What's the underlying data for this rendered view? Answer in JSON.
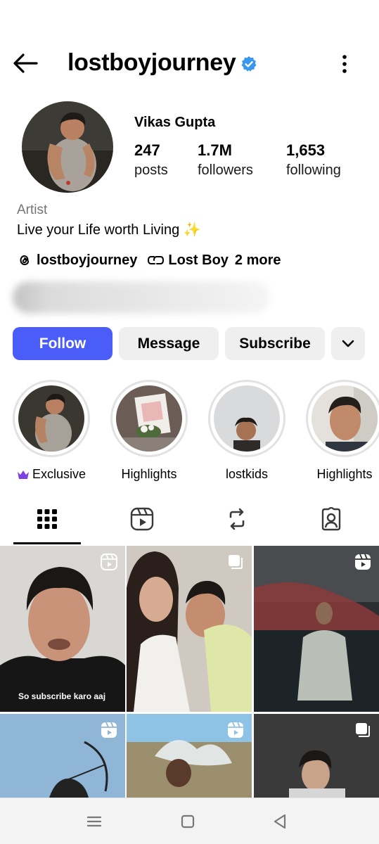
{
  "header": {
    "username": "lostboyjourney",
    "back_icon": "arrow-left-icon",
    "verified_icon": "verified-badge-icon",
    "more_icon": "vertical-dots-icon"
  },
  "profile": {
    "full_name": "Vikas Gupta",
    "stats": [
      {
        "value": "247",
        "label": "posts"
      },
      {
        "value": "1.7M",
        "label": "followers"
      },
      {
        "value": "1,653",
        "label": "following"
      }
    ],
    "category": "Artist",
    "bio": "Live your Life worth Living ✨",
    "threads_handle": "lostboyjourney",
    "link_label": "Lost Boy",
    "more_links": "2 more"
  },
  "actions": {
    "follow": "Follow",
    "message": "Message",
    "subscribe": "Subscribe",
    "dropdown_icon": "chevron-down-icon"
  },
  "highlights": [
    {
      "label": "Exclusive",
      "icon": "crown-icon"
    },
    {
      "label": "Highlights"
    },
    {
      "label": "lostkids"
    },
    {
      "label": "Highlights"
    }
  ],
  "tabs": [
    {
      "name": "posts-grid",
      "icon": "grid-icon",
      "active": true
    },
    {
      "name": "reels",
      "icon": "reels-icon"
    },
    {
      "name": "reposts",
      "icon": "repost-icon"
    },
    {
      "name": "tagged",
      "icon": "tagged-person-icon"
    }
  ],
  "posts": [
    {
      "type": "reel",
      "caption": "So subscribe karo aaj"
    },
    {
      "type": "carousel"
    },
    {
      "type": "reel"
    },
    {
      "type": "reel"
    },
    {
      "type": "reel"
    },
    {
      "type": "carousel"
    }
  ],
  "colors": {
    "accent": "#4a5df9",
    "verified": "#3897f0",
    "crown": "#7b3fe4"
  },
  "system_nav": [
    "menu-icon",
    "home-square-icon",
    "back-triangle-icon"
  ]
}
